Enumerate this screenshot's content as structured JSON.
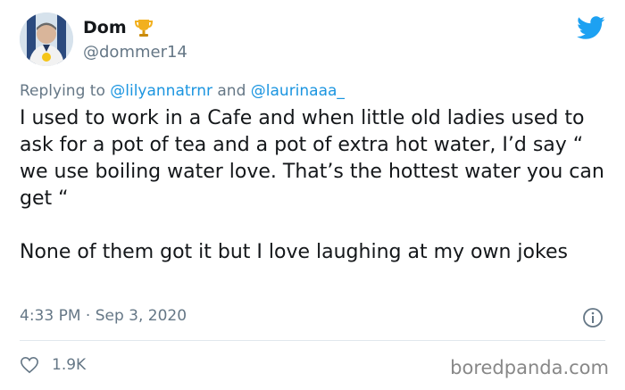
{
  "author": {
    "name": "Dom",
    "handle": "@dommer14",
    "badge_icon": "trophy-icon"
  },
  "reply": {
    "prefix": "Replying to",
    "user1": "@lilyannatrnr",
    "joiner": "and",
    "user2": "@laurinaaa_"
  },
  "tweet": {
    "paragraph1": "I used to work in a Cafe and when little old ladies used to ask for a pot of tea and a pot of extra hot water, I’d say “ we use boiling water love. That’s the hottest water you can get “",
    "paragraph2": "None of them got it but I love laughing at my own jokes"
  },
  "meta": {
    "time": "4:33 PM",
    "separator": "·",
    "date": "Sep 3, 2020"
  },
  "stats": {
    "likes": "1.9K"
  },
  "watermark": "boredpanda.com",
  "colors": {
    "twitter_blue": "#1da1f2",
    "link": "#1b95e0",
    "muted": "#657786"
  }
}
